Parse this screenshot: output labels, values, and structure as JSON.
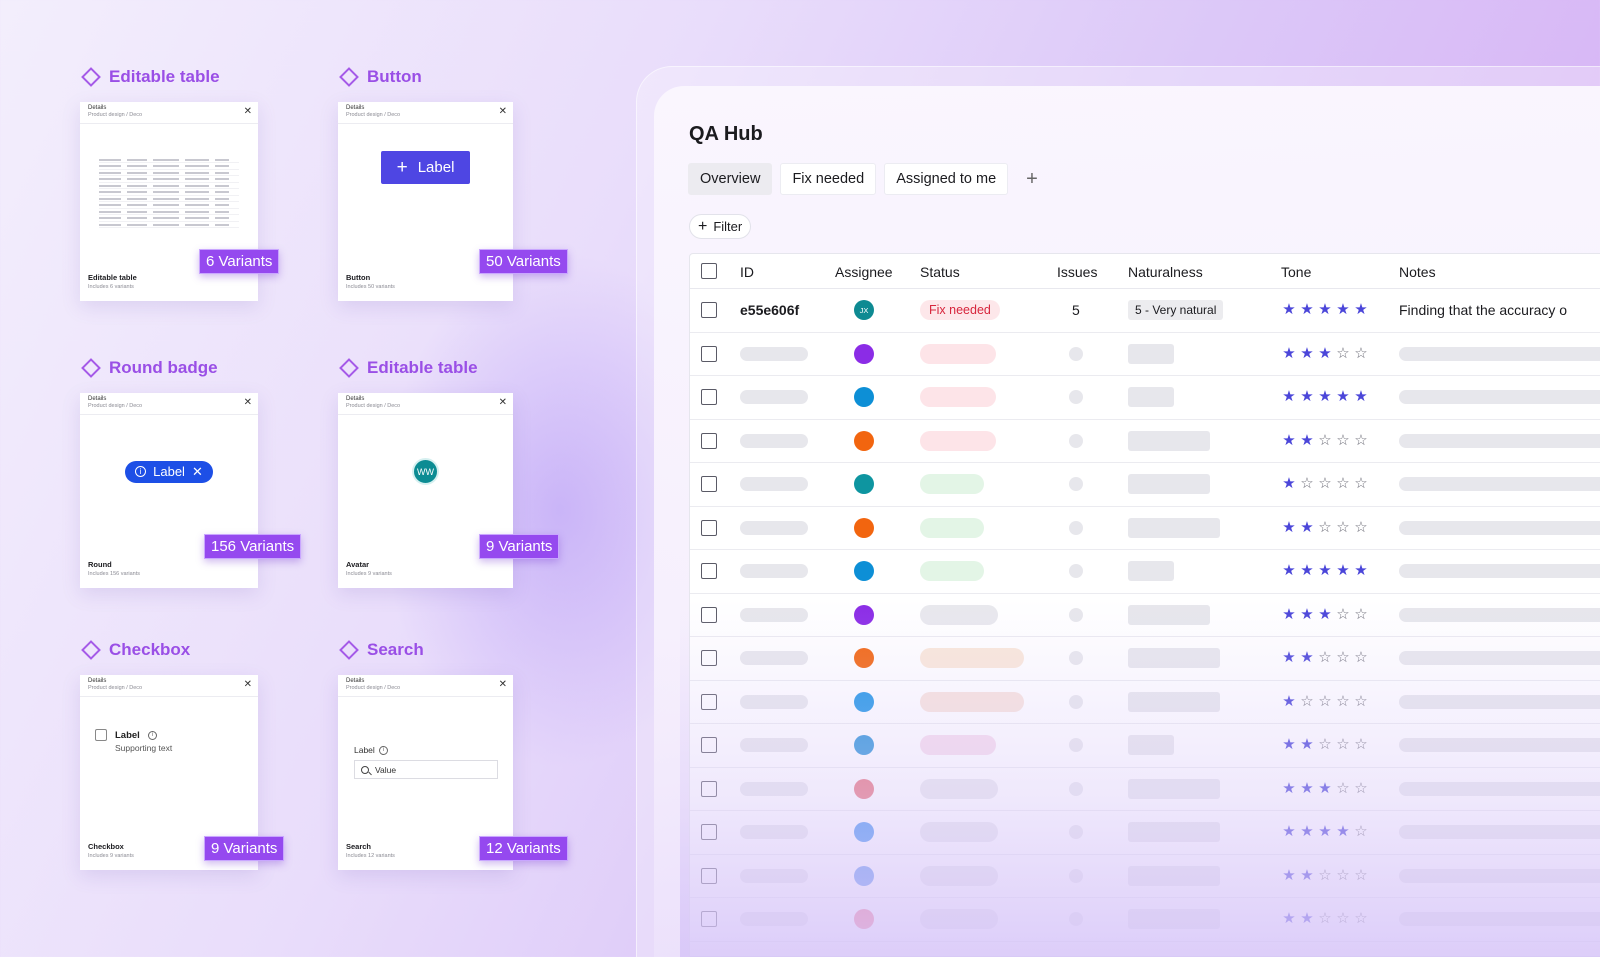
{
  "components": [
    {
      "title": "Editable table",
      "head_title": "Details",
      "head_sub": "Product design / Deco",
      "foot_title": "Editable table",
      "foot_sub": "Includes 6 variants",
      "variants": "6 Variants"
    },
    {
      "title": "Button",
      "head_title": "Details",
      "head_sub": "Product design / Deco",
      "foot_title": "Button",
      "foot_sub": "Includes 50 variants",
      "variants": "50 Variants",
      "preview_label": "Label"
    },
    {
      "title": "Round badge",
      "head_title": "Details",
      "head_sub": "Product design / Deco",
      "foot_title": "Round",
      "foot_sub": "Includes 156 variants",
      "variants": "156 Variants",
      "preview_label": "Label"
    },
    {
      "title": "Editable table",
      "head_title": "Details",
      "head_sub": "Product design / Deco",
      "foot_title": "Avatar",
      "foot_sub": "Includes 9 variants",
      "variants": "9 Variants",
      "preview_initials": "WW"
    },
    {
      "title": "Checkbox",
      "head_title": "Details",
      "head_sub": "Product design / Deco",
      "foot_title": "Checkbox",
      "foot_sub": "Includes 9 variants",
      "variants": "9 Variants",
      "preview_label": "Label",
      "preview_support": "Supporting text"
    },
    {
      "title": "Search",
      "head_title": "Details",
      "head_sub": "Product design / Deco",
      "foot_title": "Search",
      "foot_sub": "Includes 12 variants",
      "variants": "12 Variants",
      "preview_label": "Label",
      "preview_value": "Value"
    }
  ],
  "qa_hub": {
    "title": "QA Hub",
    "tabs": [
      "Overview",
      "Fix needed",
      "Assigned to me"
    ],
    "active_tab": "Overview",
    "add_tab": "+",
    "filter_label": "Filter",
    "columns": [
      "ID",
      "Assignee",
      "Status",
      "Issues",
      "Naturalness",
      "Tone",
      "Notes"
    ],
    "first_row": {
      "id": "e55e606f",
      "assignee_initials": "JX",
      "status": "Fix needed",
      "issues": "5",
      "naturalness": "5 - Very natural",
      "tone": 5,
      "notes": "Finding that the accuracy o"
    },
    "placeholder_rows": [
      {
        "assignee_color": "#8b2ce6",
        "status_color": "#fde4e8",
        "status_w": 76,
        "nat_w": 46,
        "tone": 3
      },
      {
        "assignee_color": "#0d8fd6",
        "status_color": "#fde4e8",
        "status_w": 76,
        "nat_w": 46,
        "tone": 5
      },
      {
        "assignee_color": "#f2650f",
        "status_color": "#fde4e8",
        "status_w": 76,
        "nat_w": 82,
        "tone": 2
      },
      {
        "assignee_color": "#0e95a0",
        "status_color": "#e3f5e6",
        "status_w": 64,
        "nat_w": 82,
        "tone": 1
      },
      {
        "assignee_color": "#f2650f",
        "status_color": "#e3f5e6",
        "status_w": 64,
        "nat_w": 92,
        "tone": 2
      },
      {
        "assignee_color": "#0d8fd6",
        "status_color": "#e3f5e6",
        "status_w": 64,
        "nat_w": 46,
        "tone": 5
      },
      {
        "assignee_color": "#8b2ce6",
        "status_color": "#e8e8ed",
        "status_w": 78,
        "nat_w": 82,
        "tone": 3
      },
      {
        "assignee_color": "#f2650f",
        "status_color": "#fae8d9",
        "status_w": 104,
        "nat_w": 92,
        "tone": 2
      },
      {
        "assignee_color": "#1f95e6",
        "status_color": "#f8e3dc",
        "status_w": 104,
        "nat_w": 92,
        "tone": 1
      },
      {
        "assignee_color": "#2a92d8",
        "status_color": "#f6dcec",
        "status_w": 76,
        "nat_w": 46,
        "tone": 2
      },
      {
        "assignee_color": "#e6707a",
        "status_color": "#e8e8ed",
        "status_w": 78,
        "nat_w": 92,
        "tone": 3
      },
      {
        "assignee_color": "#3c8ff0",
        "status_color": "#e8e8ed",
        "status_w": 78,
        "nat_w": 92,
        "tone": 4
      },
      {
        "assignee_color": "#5c92ee",
        "status_color": "#e8e8ed",
        "status_w": 78,
        "nat_w": 92,
        "tone": 2
      },
      {
        "assignee_color": "#f2708a",
        "status_color": "#e8e8ed",
        "status_w": 78,
        "nat_w": 92,
        "tone": 2
      }
    ]
  }
}
